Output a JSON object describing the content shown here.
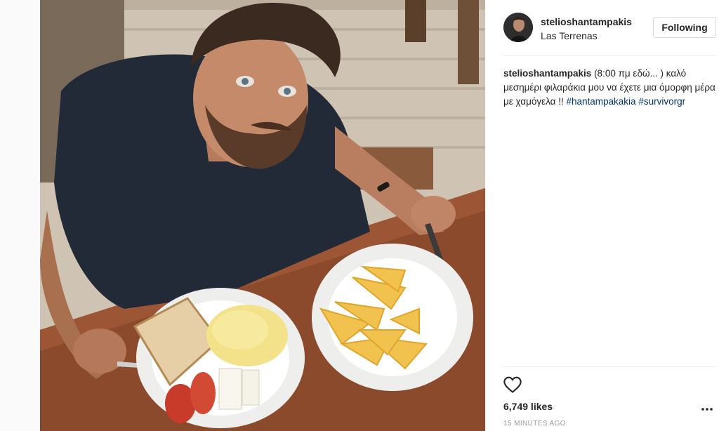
{
  "post": {
    "username": "stelioshantampakis",
    "location": "Las Terrenas",
    "follow_label": "Following",
    "caption": {
      "username": "stelioshantampakis",
      "text": "(8:00 πμ εδώ... ) καλό μεσημέρι φιλαράκια μου να έχετε μια όμορφη μέρα με χαμόγελα !!",
      "hashtags": [
        "#hantampakakia",
        "#survivorgr"
      ]
    },
    "likes": "6,749 likes",
    "timestamp": "15 MINUTES AGO"
  },
  "icons": {
    "like": "heart-outline-icon",
    "more": "more-options-icon",
    "avatar": "user-avatar"
  },
  "colors": {
    "hashtag": "#003569",
    "text": "#262626",
    "muted": "#999999",
    "border": "#dbdbdb"
  }
}
